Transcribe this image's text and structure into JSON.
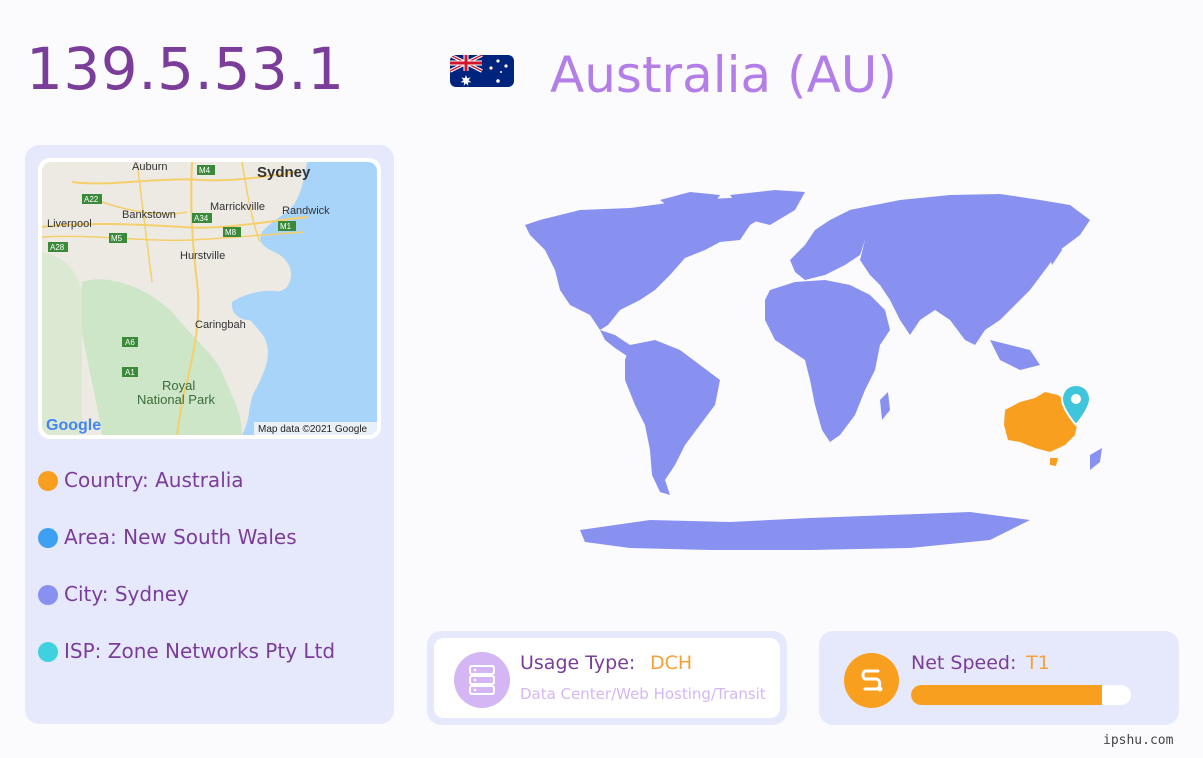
{
  "header": {
    "ip": "139.5.53.1",
    "country_title": "Australia (AU)",
    "flag_icon": "australia-flag-icon"
  },
  "map": {
    "labels": [
      "Auburn",
      "M4",
      "Sydney",
      "A22",
      "Marrickville",
      "Randwick",
      "Bankstown",
      "A34",
      "Liverpool",
      "M5",
      "M8",
      "M1",
      "A28",
      "Hurstville",
      "Caringbah",
      "A6",
      "A1",
      "Royal",
      "National Park"
    ],
    "logo": "Google",
    "attribution": "Map data ©2021 Google"
  },
  "info": [
    {
      "label": "Country: Australia",
      "color": "#f99f1f"
    },
    {
      "label": "Area: New South Wales",
      "color": "#3ea0f3"
    },
    {
      "label": "City: Sydney",
      "color": "#8891f0"
    },
    {
      "label": "ISP: Zone Networks Pty Ltd",
      "color": "#3fd1df"
    }
  ],
  "world_map": {
    "land_color": "#8891f0",
    "highlight_color": "#f99f1f",
    "marker_color": "#3fc5dc",
    "marker_icon": "location-pin-icon"
  },
  "usage": {
    "label": "Usage Type:",
    "value": "DCH",
    "description": "Data Center/Web Hosting/Transit",
    "icon": "server-icon"
  },
  "speed": {
    "label": "Net Speed:",
    "value": "T1",
    "level_percent": 87,
    "icon": "speed-icon"
  },
  "watermark": "ipshu.com"
}
